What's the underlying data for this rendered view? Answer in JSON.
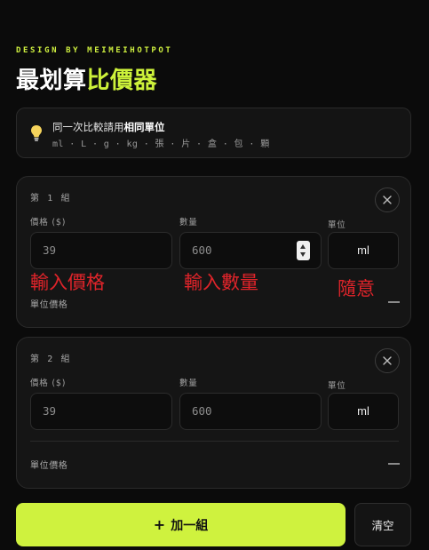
{
  "header": {
    "brand": "DESIGN BY MEIMEIHOTPOT",
    "title_part1": "最划算",
    "title_part2": "比價器",
    "accent_color": "#cdf23a"
  },
  "tip": {
    "icon": "lightbulb-icon",
    "line1_prefix": "同一次比較請用",
    "line1_emphasis": "相同單位",
    "units": "ml · L · g · kg · 張 · 片 · 盒 · 包 · 顆"
  },
  "groups": [
    {
      "title": "第 1 組",
      "price_label": "價格 ($)",
      "price_value": "39",
      "qty_label": "數量",
      "qty_value": "600",
      "unit_label": "單位",
      "unit_value": "ml",
      "annotations": {
        "price": "輸入價格",
        "qty": "輸入數量",
        "unit": "隨意"
      },
      "unit_price_label": "單位價格",
      "unit_price_value": "—"
    },
    {
      "title": "第 2 組",
      "price_label": "價格 ($)",
      "price_value": "39",
      "qty_label": "數量",
      "qty_value": "600",
      "unit_label": "單位",
      "unit_value": "ml",
      "unit_price_label": "單位價格",
      "unit_price_value": "—"
    }
  ],
  "actions": {
    "add_plus": "+",
    "add_label": "加一組",
    "clear_label": "清空"
  }
}
